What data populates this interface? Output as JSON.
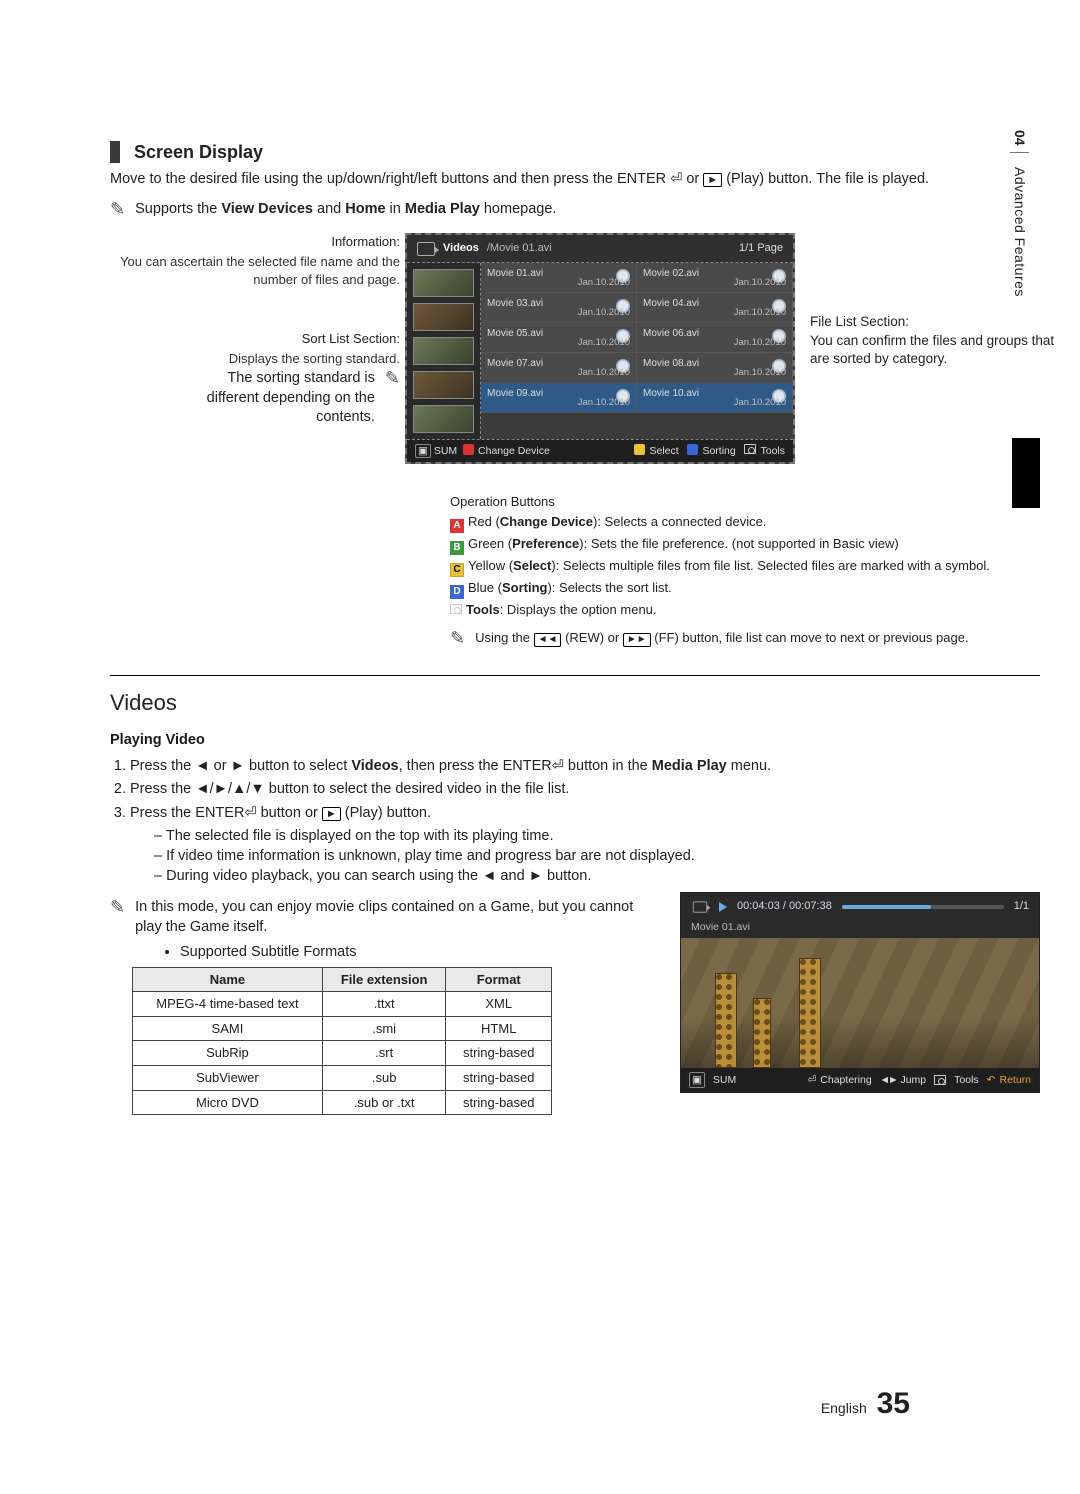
{
  "side_tab": {
    "number": "04",
    "label": "Advanced Features"
  },
  "screen_display": {
    "heading": "Screen Display",
    "intro_pre": "Move to the desired file using the up/down/right/left buttons and then press the ENTER ",
    "intro_mid": " or ",
    "intro_post": " (Play) button. The file is played.",
    "support_pre": "Supports the ",
    "support_b1": "View Devices",
    "support_mid": " and ",
    "support_b2": "Home",
    "support_mid2": " in ",
    "support_b3": "Media Play",
    "support_post": " homepage."
  },
  "callouts": {
    "info_title": "Information:",
    "info_body": "You can ascertain the selected file name and the number of files and page.",
    "sort_title": "Sort List Section:",
    "sort_body": "Displays the sorting standard.",
    "sort_note": "The sorting standard is different depending on the contents.",
    "right_title": "File List Section:",
    "right_body": "You can confirm the files and groups that are sorted by category."
  },
  "tv": {
    "crumb_main": "Videos",
    "crumb_path": "/Movie 01.avi",
    "page": "1/1 Page",
    "files": [
      {
        "name": "Movie 01.avi",
        "date": "Jan.10.2010"
      },
      {
        "name": "Movie 02.avi",
        "date": "Jan.10.2010"
      },
      {
        "name": "Movie 03.avi",
        "date": "Jan.10.2010"
      },
      {
        "name": "Movie 04.avi",
        "date": "Jan.10.2010"
      },
      {
        "name": "Movie 05.avi",
        "date": "Jan.10.2010"
      },
      {
        "name": "Movie 06.avi",
        "date": "Jan.10.2010"
      },
      {
        "name": "Movie 07.avi",
        "date": "Jan.10.2010"
      },
      {
        "name": "Movie 08.avi",
        "date": "Jan.10.2010"
      },
      {
        "name": "Movie 09.avi",
        "date": "Jan.10.2010"
      },
      {
        "name": "Movie 10.avi",
        "date": "Jan.10.2010"
      }
    ],
    "bottom_left_sum": "SUM",
    "bottom_left_a": "Change Device",
    "bottom_c": "Select",
    "bottom_d": "Sorting",
    "bottom_tools": "Tools"
  },
  "opbuttons": {
    "heading": "Operation Buttons",
    "a_pre": "Red (",
    "a_b": "Change Device",
    "a_post": "): Selects a connected device.",
    "b_pre": "Green (",
    "b_b": "Preference",
    "b_post": "): Sets the file preference. (not supported in Basic view)",
    "c_pre": "Yellow (",
    "c_b": "Select",
    "c_post": "): Selects multiple files from file list. Selected files are marked with a symbol.",
    "d_pre": "Blue (",
    "d_b": "Sorting",
    "d_post": "): Selects the sort list.",
    "tools_b": "Tools",
    "tools_post": ": Displays the option menu.",
    "rew_note": "Using the µ (REW) or ∂ (FF) button, file list can move to next or previous page.",
    "rew_label": "◄◄",
    "ff_label": "►►",
    "rew_txt1": "Using the ",
    "rew_mid": " (REW) or ",
    "rew_txt2": " (FF) button, file list can move to next or previous page."
  },
  "videos": {
    "heading": "Videos",
    "playing_h": "Playing Video",
    "s1_pre": "Press the ◄ or ► button to select ",
    "s1_b1": "Videos",
    "s1_mid": ", then press the ENTER",
    "s1_post": " button in the ",
    "s1_b2": "Media Play",
    "s1_end": " menu.",
    "s2": "Press the ◄/►/▲/▼ button to select the desired video in the file list.",
    "s3_pre": "Press the ENTER",
    "s3_mid": " button or ",
    "s3_post": " (Play) button.",
    "d1": "The selected file is displayed on the top with its playing time.",
    "d2": "If video time information is unknown, play time and progress bar are not displayed.",
    "d3": "During video playback, you can search using the ◄ and ► button.",
    "note_game": "In this mode, you can enjoy movie clips contained on a Game, but you cannot play the Game itself.",
    "bullet_subs": "Supported Subtitle Formats"
  },
  "subs_table": {
    "headers": [
      "Name",
      "File extension",
      "Format"
    ],
    "rows": [
      [
        "MPEG-4 time-based text",
        ".ttxt",
        "XML"
      ],
      [
        "SAMI",
        ".smi",
        "HTML"
      ],
      [
        "SubRip",
        ".srt",
        "string-based"
      ],
      [
        "SubViewer",
        ".sub",
        "string-based"
      ],
      [
        "Micro DVD",
        ".sub or .txt",
        "string-based"
      ]
    ]
  },
  "playback": {
    "time": "00:04:03 / 00:07:38",
    "count": "1/1",
    "file": "Movie 01.avi",
    "sum": "SUM",
    "chaptering": "Chaptering",
    "jump": "Jump",
    "tools": "Tools",
    "return": "Return"
  },
  "footer": {
    "lang": "English",
    "page": "35"
  }
}
